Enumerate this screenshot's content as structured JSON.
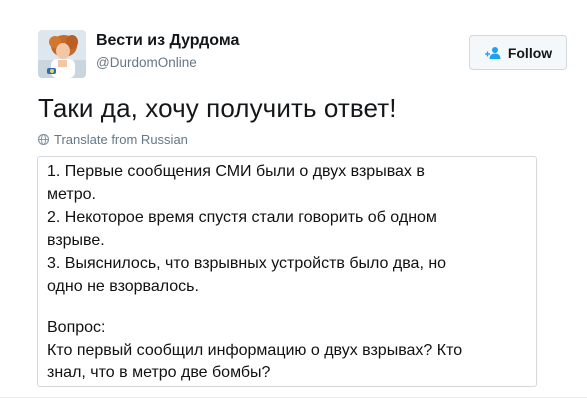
{
  "account": {
    "display_name": "Вести из Дурдома",
    "handle": "@DurdomOnline",
    "avatar_icon": "avatar-photo"
  },
  "follow_button": {
    "label": "Follow",
    "icon": "person-add-icon"
  },
  "tweet": {
    "text": "Таки да, хочу получить ответ!"
  },
  "translate": {
    "icon": "globe-icon",
    "label": "Translate from Russian"
  },
  "image_text": {
    "lines": [
      "1. Первые сообщения СМИ были о двух взрывах в",
      "метро.",
      "2. Некоторое время спустя стали говорить об одном",
      "взрыве.",
      "3. Выяснилось, что взрывных устройств было два, но",
      "одно не взорвалось.",
      "",
      "Вопрос:",
      "Кто первый сообщил информацию о двух взрывах? Кто",
      "знал, что в метро две бомбы?"
    ]
  },
  "colors": {
    "primary_text": "#14171a",
    "secondary_text": "#657786",
    "button_background": "#f5f8fa",
    "border": "#d5d8dc"
  }
}
